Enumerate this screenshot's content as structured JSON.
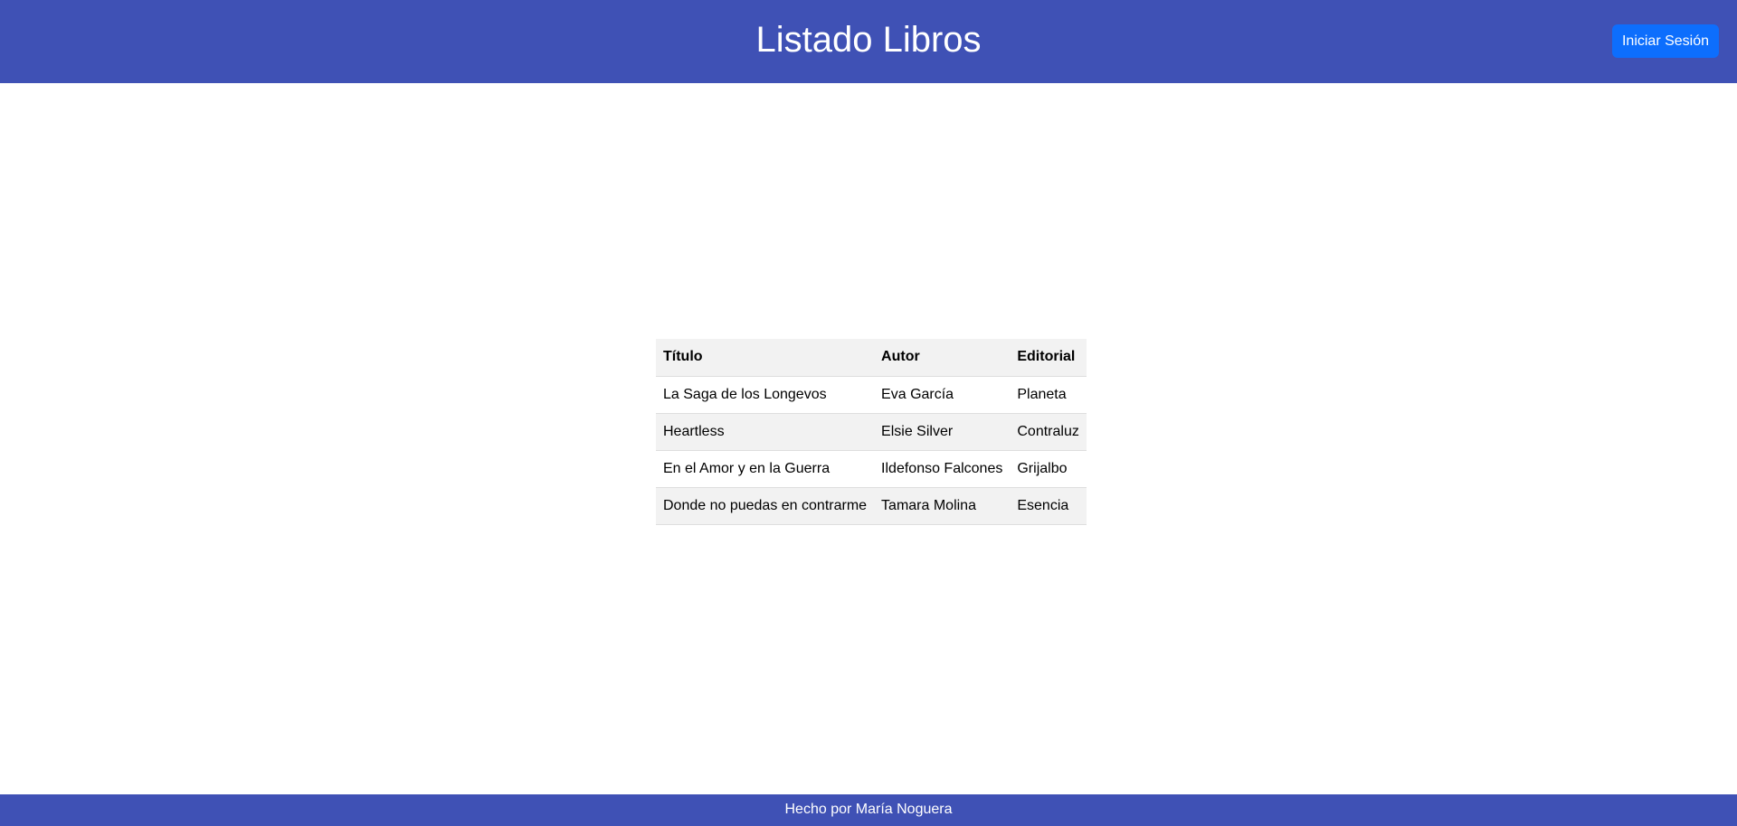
{
  "header": {
    "title": "Listado Libros",
    "login_label": "Iniciar Sesión"
  },
  "table": {
    "columns": [
      "Título",
      "Autor",
      "Editorial"
    ],
    "rows": [
      [
        "La Saga de los Longevos",
        "Eva García",
        "Planeta"
      ],
      [
        "Heartless",
        "Elsie Silver",
        "Contraluz"
      ],
      [
        "En el Amor y en la Guerra",
        "Ildefonso Falcones",
        "Grijalbo"
      ],
      [
        "Donde no puedas en contrarme",
        "Tamara Molina",
        "Esencia"
      ]
    ]
  },
  "footer": {
    "text": "Hecho por María Noguera"
  },
  "colors": {
    "header_bg": "#3f51b5",
    "button_bg": "#0d6efd",
    "row_stripe": "#f2f2f2"
  }
}
